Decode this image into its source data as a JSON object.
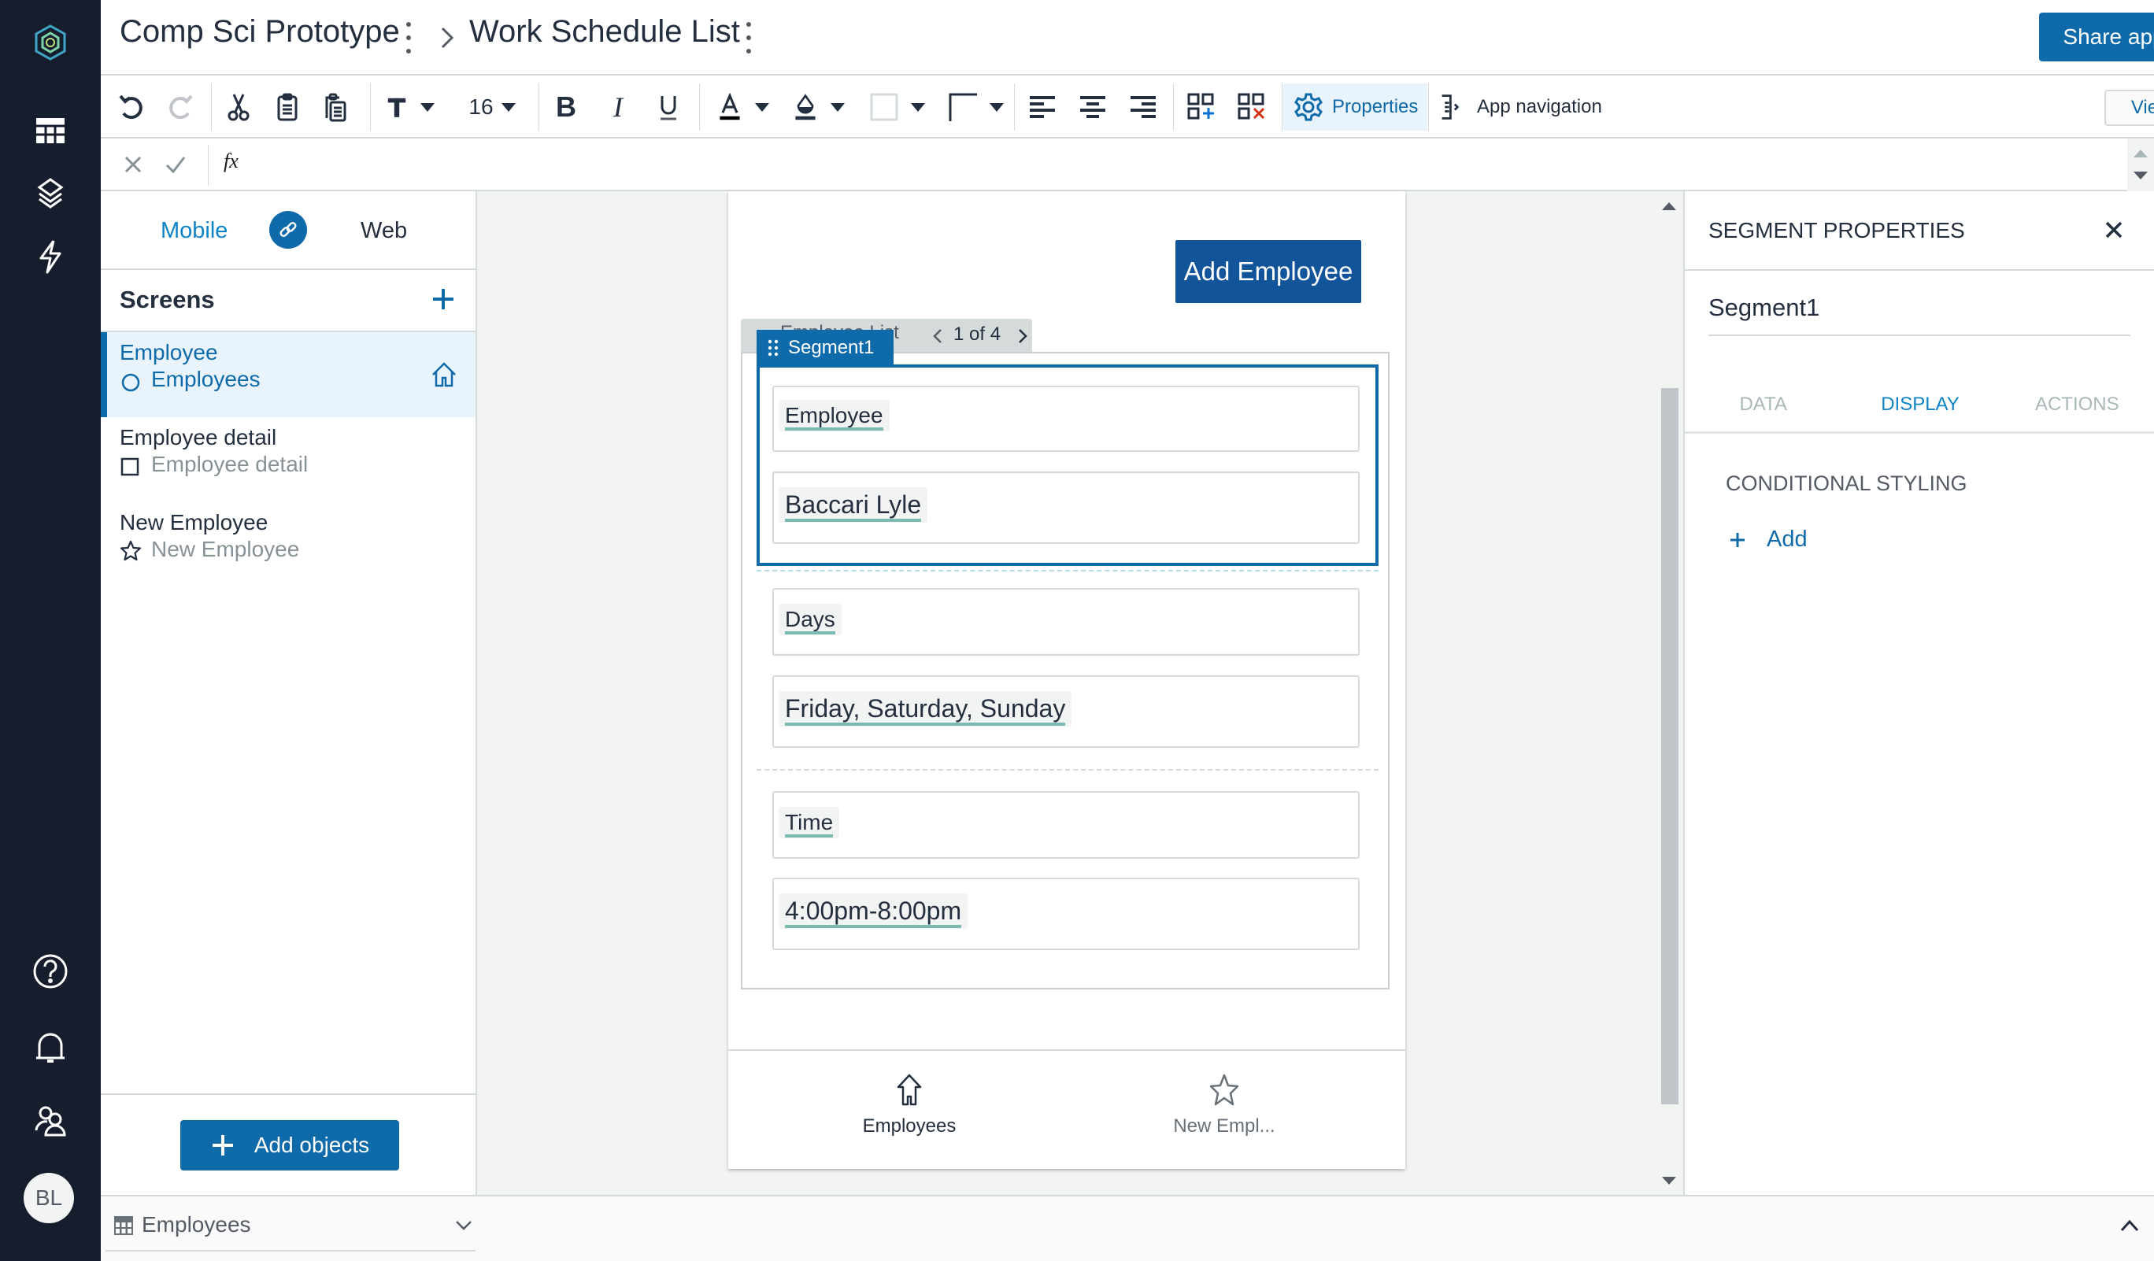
{
  "header": {
    "app_name": "Comp Sci Prototype",
    "table_name": "Work Schedule List",
    "share_label": "Share app"
  },
  "toolbar": {
    "font_size": "16",
    "properties_label": "Properties",
    "app_navigation_label": "App navigation",
    "view_app_label": "View app"
  },
  "formula_bar": {
    "fx_label": "fx",
    "value": ""
  },
  "left_panel": {
    "mode_mobile": "Mobile",
    "mode_web": "Web",
    "screens_title": "Screens",
    "screens": [
      {
        "title": "Employee",
        "subtitle": "Employees",
        "icon": "circle-icon",
        "selected": true,
        "home": true
      },
      {
        "title": "Employee detail",
        "subtitle": "Employee detail",
        "icon": "square-icon",
        "selected": false
      },
      {
        "title": "New Employee",
        "subtitle": "New Employee",
        "icon": "star-icon",
        "selected": false
      }
    ],
    "add_objects_label": "Add objects"
  },
  "canvas": {
    "add_employee_label": "Add Employee",
    "list_label": "Employee List",
    "pagination": "1 of 4",
    "segment_label": "Segment1",
    "fields": [
      {
        "label": "Employee",
        "value": "Baccari Lyle"
      },
      {
        "label": "Days",
        "value": "Friday, Saturday, Sunday"
      },
      {
        "label": "Time",
        "value": "4:00pm-8:00pm"
      }
    ],
    "bottom_nav": [
      {
        "label": "Employees",
        "icon": "home-icon",
        "active": true
      },
      {
        "label": "New Empl...",
        "icon": "star-icon",
        "active": false
      }
    ]
  },
  "right_panel": {
    "title": "SEGMENT PROPERTIES",
    "name_value": "Segment1",
    "tabs": [
      "DATA",
      "DISPLAY",
      "ACTIONS"
    ],
    "active_tab": "DISPLAY",
    "section_title": "CONDITIONAL STYLING",
    "add_label": "Add"
  },
  "bottom_bar": {
    "table_label": "Employees"
  },
  "user": {
    "initials": "BL"
  },
  "colors": {
    "primary": "#0f6aa9",
    "nav_bg": "#161e2d",
    "selected_bg": "#e8f3fc",
    "underline": "#7bb9b3"
  }
}
